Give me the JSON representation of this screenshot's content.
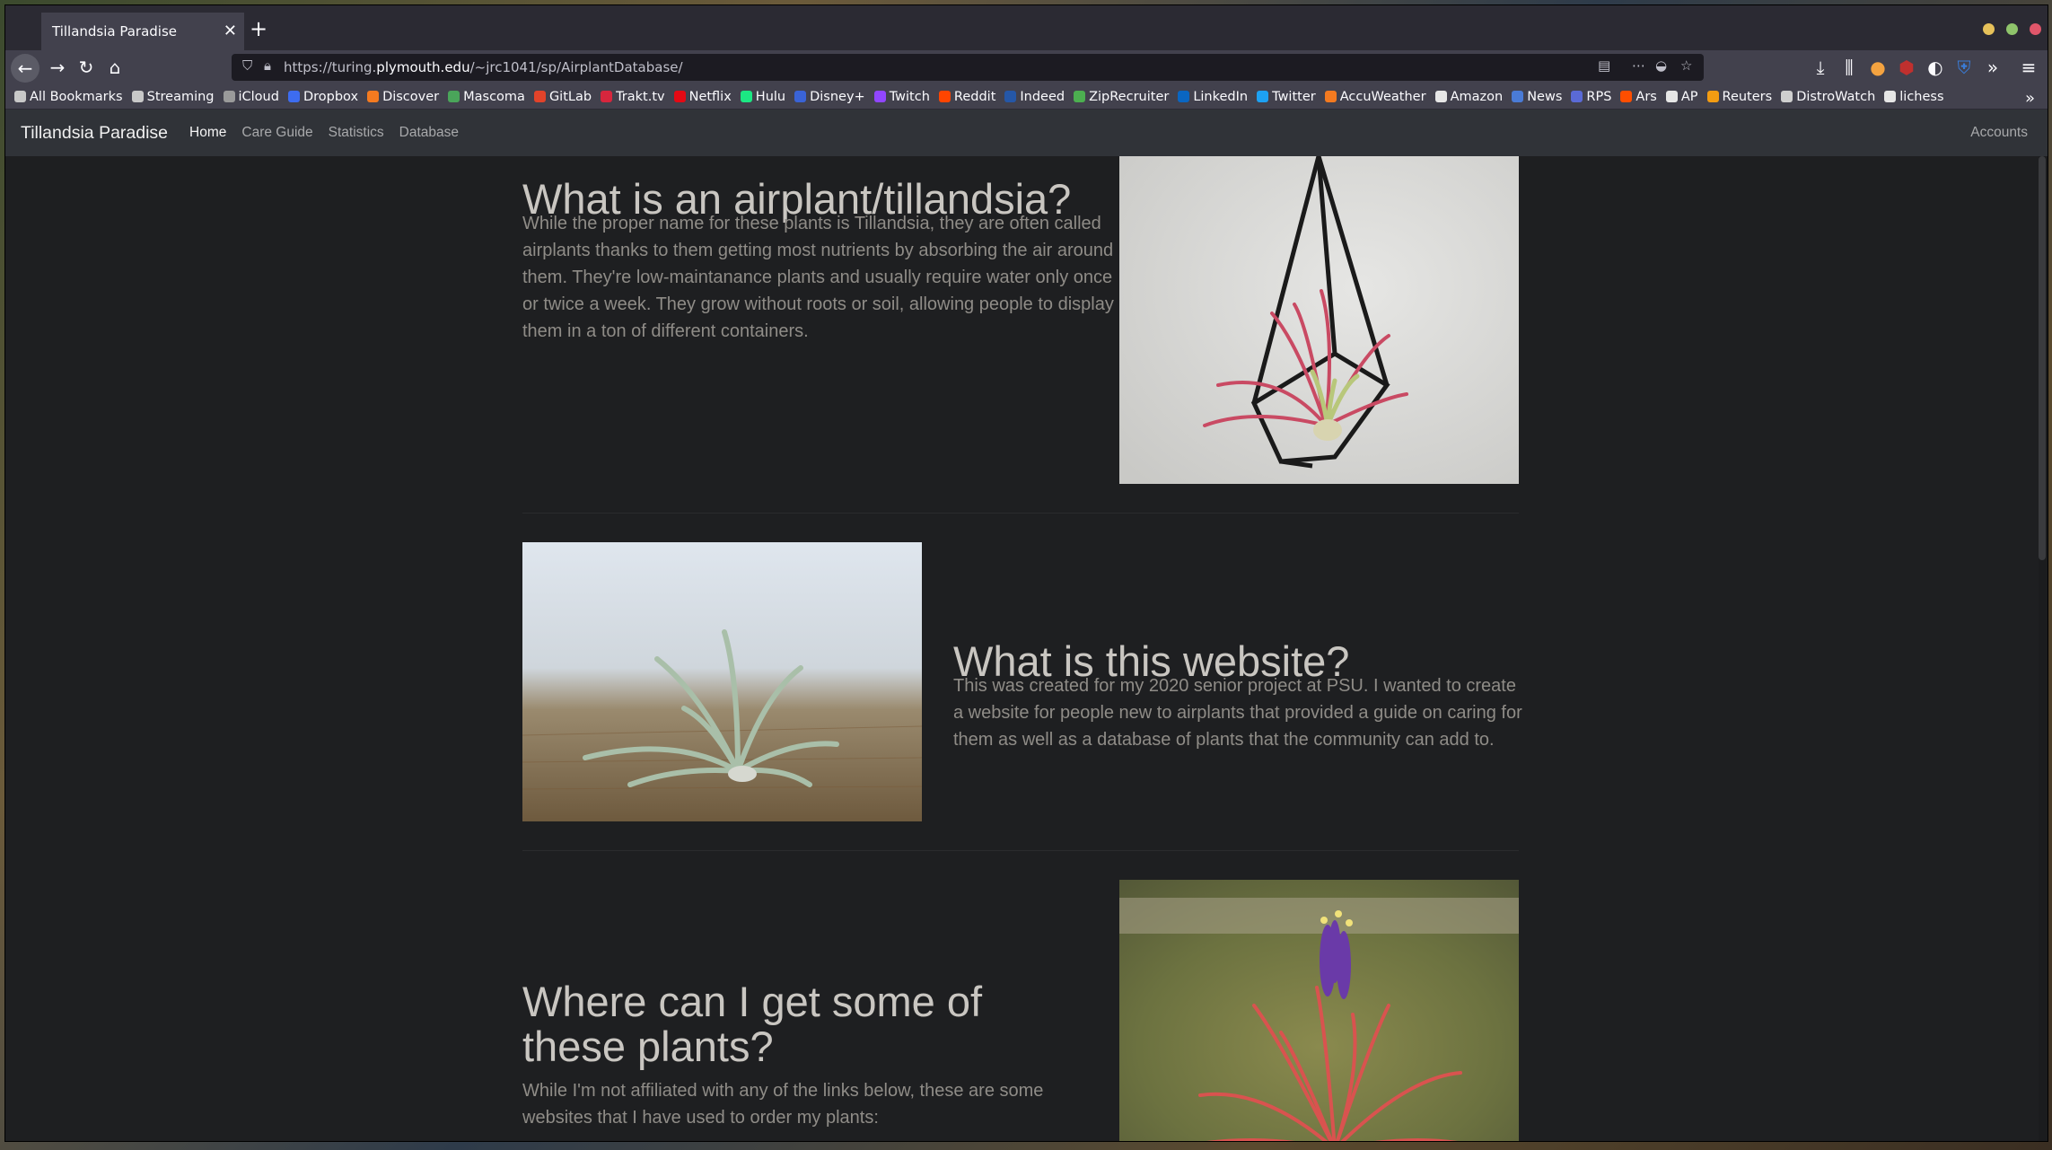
{
  "browser": {
    "tab_title": "Tillandsia Paradise",
    "url_prefix": "https://turing.",
    "url_host": "plymouth.edu",
    "url_path": "/~jrc1041/sp/AirplantDatabase/",
    "bookmarks": [
      {
        "label": "All Bookmarks",
        "color": "#c8c8c8"
      },
      {
        "label": "Streaming",
        "color": "#c8c8c8"
      },
      {
        "label": "iCloud",
        "color": "#9a9a9a"
      },
      {
        "label": "Dropbox",
        "color": "#3d6cf0"
      },
      {
        "label": "Discover",
        "color": "#f47a20"
      },
      {
        "label": "Mascoma",
        "color": "#4aa55a"
      },
      {
        "label": "GitLab",
        "color": "#e2432a"
      },
      {
        "label": "Trakt.tv",
        "color": "#d7263d"
      },
      {
        "label": "Netflix",
        "color": "#e50914"
      },
      {
        "label": "Hulu",
        "color": "#1ce783"
      },
      {
        "label": "Disney+",
        "color": "#3a63d6"
      },
      {
        "label": "Twitch",
        "color": "#9146ff"
      },
      {
        "label": "Reddit",
        "color": "#ff4500"
      },
      {
        "label": "Indeed",
        "color": "#2557a7"
      },
      {
        "label": "ZipRecruiter",
        "color": "#4caf50"
      },
      {
        "label": "LinkedIn",
        "color": "#0a66c2"
      },
      {
        "label": "Twitter",
        "color": "#1da1f2"
      },
      {
        "label": "AccuWeather",
        "color": "#f47a20"
      },
      {
        "label": "Amazon",
        "color": "#e6e6e6"
      },
      {
        "label": "News",
        "color": "#4a7bd6"
      },
      {
        "label": "RPS",
        "color": "#5a6ad6"
      },
      {
        "label": "Ars",
        "color": "#ff4e00"
      },
      {
        "label": "AP",
        "color": "#e6e6e6"
      },
      {
        "label": "Reuters",
        "color": "#f39c12"
      },
      {
        "label": "DistroWatch",
        "color": "#cfcfcf"
      },
      {
        "label": "lichess",
        "color": "#e6e6e6"
      }
    ]
  },
  "site": {
    "brand": "Tillandsia Paradise",
    "nav": {
      "home": "Home",
      "care_guide": "Care Guide",
      "statistics": "Statistics",
      "database": "Database",
      "accounts": "Accounts"
    }
  },
  "sections": {
    "s1": {
      "heading": "What is an airplant/tillandsia?",
      "body": "While the proper name for these plants is Tillandsia, they are often called airplants thanks to them getting most nutrients by absorbing the air around them. They're low-maintanance plants and usually require water only once or twice a week. They grow without roots or soil, allowing people to display them in a ton of different containers."
    },
    "s2": {
      "heading": "What is this website?",
      "body": "This was created for my 2020 senior project at PSU. I wanted to create a website for people new to airplants that provided a guide on caring for them as well as a database of plants that the community can add to."
    },
    "s3": {
      "heading": "Where can I get some of these plants?",
      "body": "While I'm not affiliated with any of the links below, these are some websites that I have used to order my plants:"
    }
  },
  "colors": {
    "page_bg": "#1e1f21",
    "navbar_bg": "#303338",
    "heading": "#c9c6c1",
    "body_text": "#8f8c87"
  }
}
